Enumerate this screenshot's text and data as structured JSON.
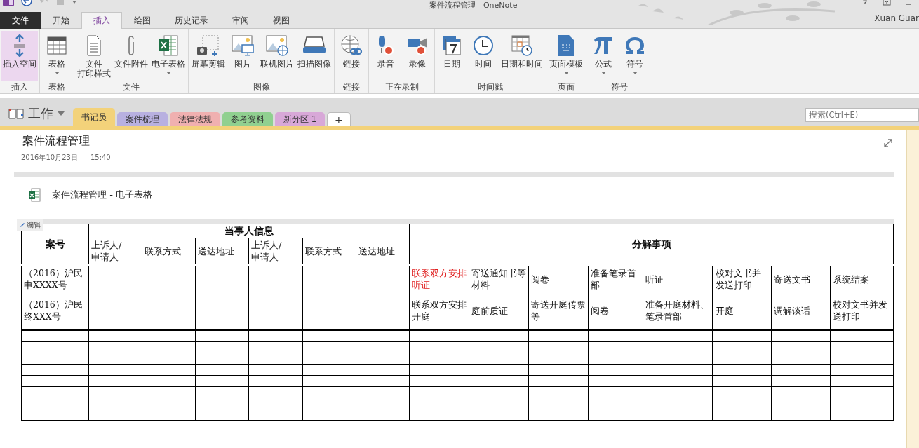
{
  "window": {
    "title": "案件流程管理 - OneNote",
    "user": "Xuan Guar"
  },
  "menu_tabs": [
    {
      "label": "文件",
      "kind": "file",
      "selected": false
    },
    {
      "label": "开始",
      "kind": "tab",
      "selected": false
    },
    {
      "label": "插入",
      "kind": "tab",
      "selected": true
    },
    {
      "label": "绘图",
      "kind": "tab",
      "selected": false
    },
    {
      "label": "历史记录",
      "kind": "tab",
      "selected": false
    },
    {
      "label": "审阅",
      "kind": "tab",
      "selected": false
    },
    {
      "label": "视图",
      "kind": "tab",
      "selected": false
    }
  ],
  "ribbon": [
    {
      "label": "插入",
      "buttons": [
        {
          "label": "插入空间",
          "highlighted": true,
          "dropdown": false
        }
      ]
    },
    {
      "label": "表格",
      "buttons": [
        {
          "label": "表格",
          "highlighted": false,
          "dropdown": true
        }
      ]
    },
    {
      "label": "文件",
      "buttons": [
        {
          "lines": [
            "文件",
            "打印样式"
          ],
          "highlighted": false,
          "dropdown": false
        },
        {
          "label": "文件附件",
          "highlighted": false,
          "dropdown": false
        },
        {
          "label": "电子表格",
          "highlighted": false,
          "dropdown": true
        }
      ]
    },
    {
      "label": "图像",
      "buttons": [
        {
          "label": "屏幕剪辑",
          "highlighted": false,
          "dropdown": false
        },
        {
          "label": "图片",
          "highlighted": false,
          "dropdown": false
        },
        {
          "label": "联机图片",
          "highlighted": false,
          "dropdown": false
        },
        {
          "label": "扫描图像",
          "highlighted": false,
          "dropdown": false
        }
      ]
    },
    {
      "label": "链接",
      "buttons": [
        {
          "label": "链接",
          "highlighted": false,
          "dropdown": false
        }
      ]
    },
    {
      "label": "正在录制",
      "buttons": [
        {
          "label": "录音",
          "highlighted": false,
          "dropdown": false
        },
        {
          "label": "录像",
          "highlighted": false,
          "dropdown": false
        }
      ]
    },
    {
      "label": "时间戳",
      "buttons": [
        {
          "label": "日期",
          "highlighted": false,
          "dropdown": false
        },
        {
          "label": "时间",
          "highlighted": false,
          "dropdown": false
        },
        {
          "label": "日期和时间",
          "highlighted": false,
          "dropdown": false
        }
      ]
    },
    {
      "label": "页面",
      "buttons": [
        {
          "label": "页面模板",
          "highlighted": false,
          "dropdown": true
        }
      ]
    },
    {
      "label": "符号",
      "buttons": [
        {
          "label": "公式",
          "highlighted": false,
          "dropdown": true
        },
        {
          "label": "符号",
          "highlighted": false,
          "dropdown": true
        }
      ]
    }
  ],
  "notebook": {
    "name": "工作",
    "sections": [
      {
        "label": "书记员",
        "color": "#f3d27a",
        "selected": true
      },
      {
        "label": "案件梳理",
        "color": "#b8b0e0",
        "selected": false
      },
      {
        "label": "法律法规",
        "color": "#f0b0b0",
        "selected": false
      },
      {
        "label": "参考资料",
        "color": "#90d090",
        "selected": false
      },
      {
        "label": "新分区 1",
        "color": "#d8a8d8",
        "selected": false
      }
    ],
    "add_tab": "+",
    "search": {
      "placeholder": "搜索(Ctrl+E)"
    }
  },
  "page": {
    "title": "案件流程管理",
    "date": "2016年10月23日",
    "time": "15:40",
    "attachment": "案件流程管理 - 电子表格",
    "edit_tag": "编辑",
    "table": {
      "case_header": "案号",
      "party_header": "当事人信息",
      "party_columns": [
        "上诉人/申请人",
        "联系方式",
        "送达地址",
        "上诉人/申请人",
        "联系方式",
        "送达地址"
      ],
      "tasks_header": "分解事项",
      "rows": [
        {
          "kind": "case",
          "case_no": "（2016）沪民申XXXX号",
          "tasks": [
            {
              "text": "联系双方安排听证",
              "struck": true
            },
            {
              "text": "寄送通知书等材料",
              "struck": false
            },
            {
              "text": "阅卷",
              "struck": false
            },
            {
              "text": "准备笔录首部",
              "struck": false
            },
            {
              "text": "听证",
              "struck": false
            },
            {
              "text": "校对文书并发送打印",
              "struck": false
            },
            {
              "text": "寄送文书",
              "struck": false
            },
            {
              "text": "系统结案",
              "struck": false
            }
          ]
        },
        {
          "kind": "case",
          "case_no": "（2016）沪民终XXX号",
          "tasks": [
            {
              "text": "联系双方安排开庭",
              "struck": false
            },
            {
              "text": "庭前质证",
              "struck": false
            },
            {
              "text": "寄送开庭传票等",
              "struck": false
            },
            {
              "text": "阅卷",
              "struck": false
            },
            {
              "text": "准备开庭材料、笔录首部",
              "struck": false
            },
            {
              "text": "开庭",
              "struck": false
            },
            {
              "text": "调解谈话",
              "struck": false
            },
            {
              "text": "校对文书并发送打印",
              "struck": false
            }
          ]
        },
        {
          "kind": "blank"
        },
        {
          "kind": "blank"
        },
        {
          "kind": "blank"
        },
        {
          "kind": "blank"
        },
        {
          "kind": "blank"
        },
        {
          "kind": "blank"
        },
        {
          "kind": "blank"
        },
        {
          "kind": "blank"
        }
      ]
    }
  }
}
